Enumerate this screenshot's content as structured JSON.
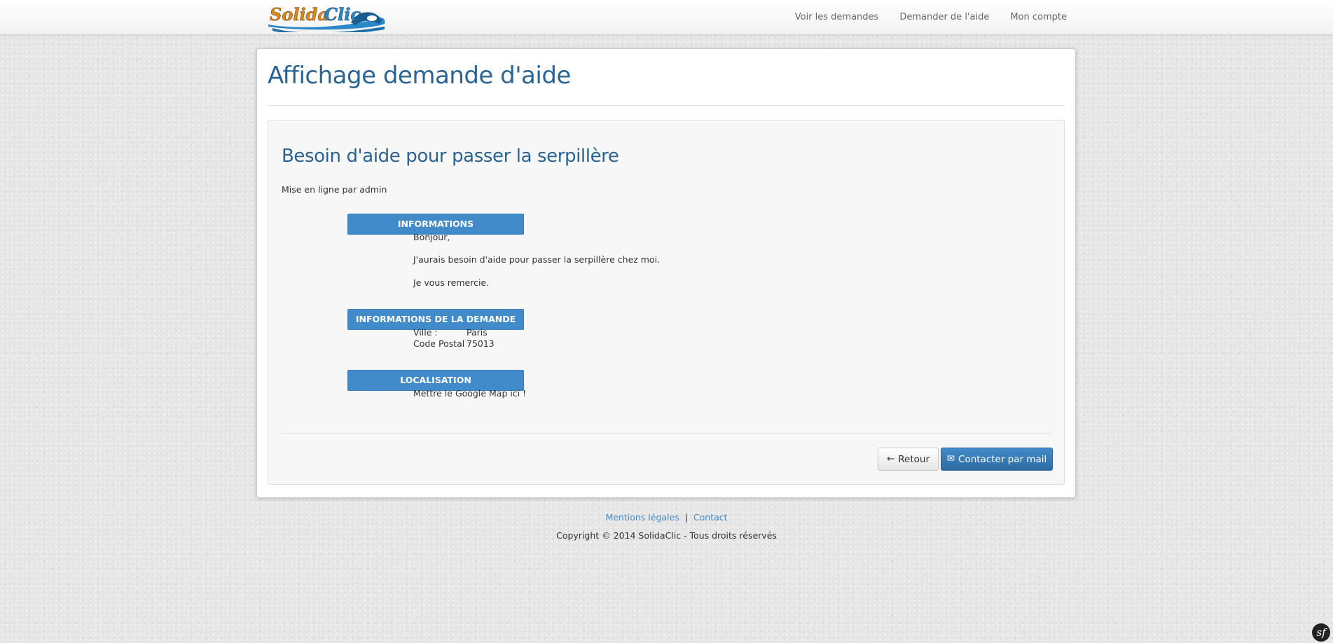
{
  "brand": {
    "logo_text": "SolidaClic",
    "colors": {
      "primary": "#428bca",
      "title": "#2a6496",
      "logo_orange": "#d98a1f",
      "logo_blue": "#2a88c6"
    }
  },
  "nav": {
    "items": [
      {
        "label": "Voir les demandes"
      },
      {
        "label": "Demander de l'aide"
      },
      {
        "label": "Mon compte"
      }
    ]
  },
  "page": {
    "title": "Affichage demande d'aide"
  },
  "request": {
    "title": "Besoin d'aide pour passer la serpillère",
    "posted_by": "Mise en ligne par admin",
    "sections": {
      "info": {
        "header": "INFORMATIONS",
        "lines": [
          "Bonjour,",
          "J'aurais besoin d'aide pour passer la serpillère chez moi.",
          "Je vous remercie."
        ]
      },
      "details": {
        "header": "INFORMATIONS DE LA DEMANDE",
        "city_label": "Ville :",
        "city_value": "Paris",
        "postal_label": "Code Postal :",
        "postal_value": "75013"
      },
      "location": {
        "header": "LOCALISATION",
        "placeholder": "Mettre le Google Map ici !"
      }
    }
  },
  "actions": {
    "back": {
      "label": "Retour",
      "icon": "arrow-left-icon",
      "glyph": "←"
    },
    "contact": {
      "label": "Contacter par mail",
      "icon": "envelope-icon",
      "glyph": "✉"
    }
  },
  "footer": {
    "legal_label": "Mentions légales",
    "separator": "|",
    "contact_label": "Contact",
    "copyright": "Copyright © 2014 SolidaClic - Tous droits réservés"
  },
  "debug_toolbar": {
    "icon": "symfony-icon",
    "glyph": "sf"
  }
}
